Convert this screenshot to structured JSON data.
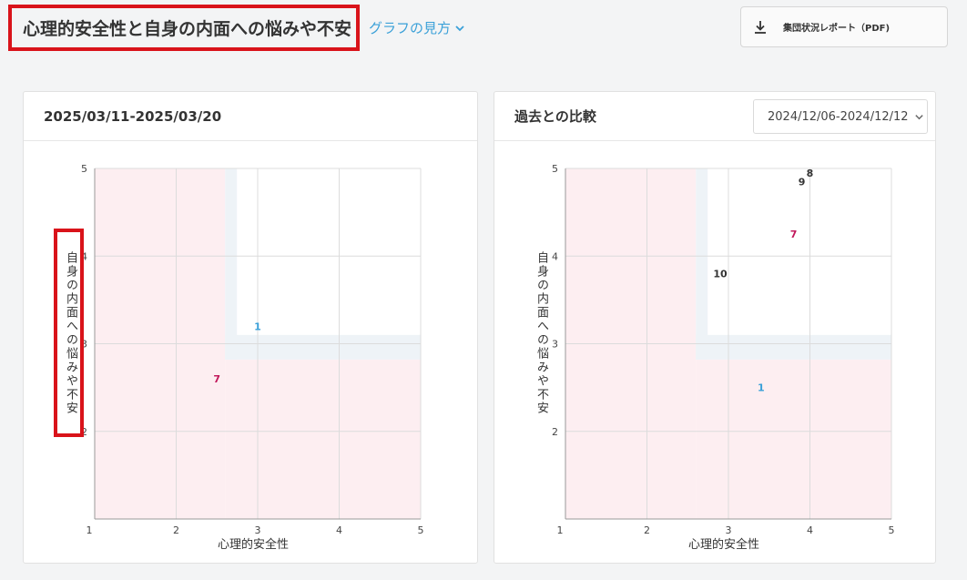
{
  "header": {
    "title": "心理的安全性と自身の内面への悩みや不安",
    "guide_link": "グラフの見方",
    "report_button": "集団状況レポート（PDF)"
  },
  "icons": {
    "guide_chevron": "chevron-down-icon",
    "download": "download-icon",
    "select_chevron": "chevron-down-icon"
  },
  "colors": {
    "accent": "#3aa0d8",
    "danger_zone": "#fdeef1",
    "neutral_zone": "#eef3f7",
    "highlight_border": "#d9131a",
    "label_blue": "#3aa0d8",
    "label_red": "#c2185b",
    "label_dark": "#333333"
  },
  "left_panel": {
    "title": "2025/03/11-2025/03/20"
  },
  "right_panel": {
    "title": "過去との比較",
    "date_select": "2024/12/06-2024/12/12"
  },
  "chart_data": [
    {
      "type": "scatter",
      "xlabel": "心理的安全性",
      "ylabel": "自身の内面への悩みや不安",
      "xlim": [
        1,
        5
      ],
      "ylim": [
        1,
        5
      ],
      "xticks": [
        1,
        2,
        3,
        4,
        5
      ],
      "yticks": [
        2,
        3,
        4,
        5
      ],
      "grid": true,
      "points": [
        {
          "label": "1",
          "x": 3.0,
          "y": 3.2,
          "color": "blue"
        },
        {
          "label": "7",
          "x": 2.5,
          "y": 2.6,
          "color": "red"
        }
      ]
    },
    {
      "type": "scatter",
      "xlabel": "心理的安全性",
      "ylabel": "自身の内面への悩みや不安",
      "xlim": [
        1,
        5
      ],
      "ylim": [
        1,
        5
      ],
      "xticks": [
        1,
        2,
        3,
        4,
        5
      ],
      "yticks": [
        2,
        3,
        4,
        5
      ],
      "grid": true,
      "points": [
        {
          "label": "8",
          "x": 4.0,
          "y": 4.95,
          "color": "dark"
        },
        {
          "label": "9",
          "x": 3.9,
          "y": 4.85,
          "color": "dark"
        },
        {
          "label": "7",
          "x": 3.8,
          "y": 4.25,
          "color": "red"
        },
        {
          "label": "10",
          "x": 2.9,
          "y": 3.8,
          "color": "dark"
        },
        {
          "label": "1",
          "x": 3.4,
          "y": 2.5,
          "color": "blue"
        }
      ]
    }
  ]
}
